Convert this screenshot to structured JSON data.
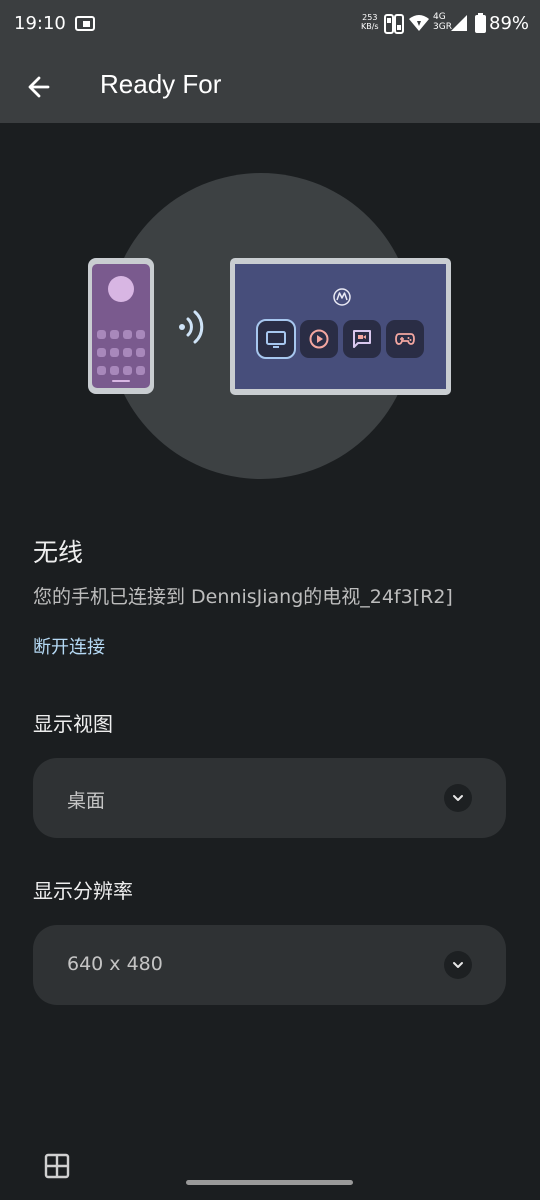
{
  "status_bar": {
    "time": "19:10",
    "net_speed_value": "253",
    "net_speed_unit": "KB/s",
    "network_top": "4G",
    "network_bottom": "3GR",
    "battery": "89%",
    "icons": [
      "cast-icon",
      "hd-icon",
      "wifi-icon",
      "signal-icon",
      "battery-icon"
    ]
  },
  "app_bar": {
    "title": "Ready For",
    "back_icon": "arrow-back-icon"
  },
  "illustration": {
    "phone_icon": "phone-icon",
    "cast_icon": "wireless-cast-icon",
    "tv_logo": "motorola-logo-icon",
    "tv_apps": [
      "tv-icon",
      "play-icon",
      "video-chat-icon",
      "gamepad-icon"
    ]
  },
  "connection": {
    "title": "无线",
    "description": "您的手机已连接到 DennisJiang的电视_24f3[R2]",
    "disconnect_label": "断开连接"
  },
  "display_view": {
    "label": "显示视图",
    "value": "桌面"
  },
  "resolution": {
    "label": "显示分辨率",
    "value": "640 x 480"
  },
  "bottom": {
    "grid_icon": "grid-icon"
  },
  "colors": {
    "background": "#1b1e20",
    "app_bar": "#3b3e40",
    "link": "#b6daf5",
    "dropdown": "#2f3234",
    "tv_screen": "#474e7b",
    "phone_screen": "#7a5a8e"
  }
}
